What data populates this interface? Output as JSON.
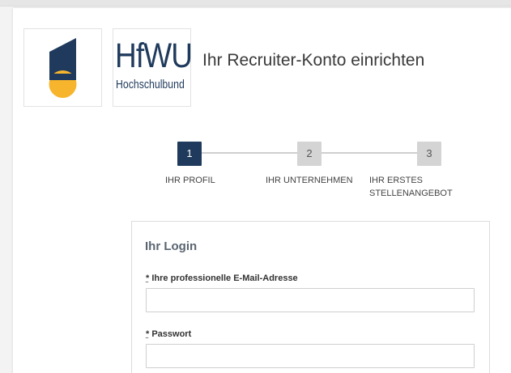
{
  "header": {
    "logo_text": "HfWU",
    "logo_subtext": "Hochschulbund",
    "title": "Ihr Recruiter-Konto einrichten"
  },
  "steps": [
    {
      "number": "1",
      "label": "IHR PROFIL",
      "active": true
    },
    {
      "number": "2",
      "label": "IHR UNTERNEHMEN",
      "active": false
    },
    {
      "number": "3",
      "label_line1": "IHR ERSTES",
      "label_line2": "STELLENANGEBOT",
      "active": false
    }
  ],
  "login": {
    "title": "Ihr Login",
    "required_marker": "*",
    "email_label": "Ihre professionelle E-Mail-Adresse",
    "email_value": "",
    "password_label": "Passwort",
    "password_value": ""
  },
  "colors": {
    "brand_navy": "#1f3a5c",
    "brand_yellow": "#f7b52e",
    "step_inactive": "#d4d4d4"
  }
}
